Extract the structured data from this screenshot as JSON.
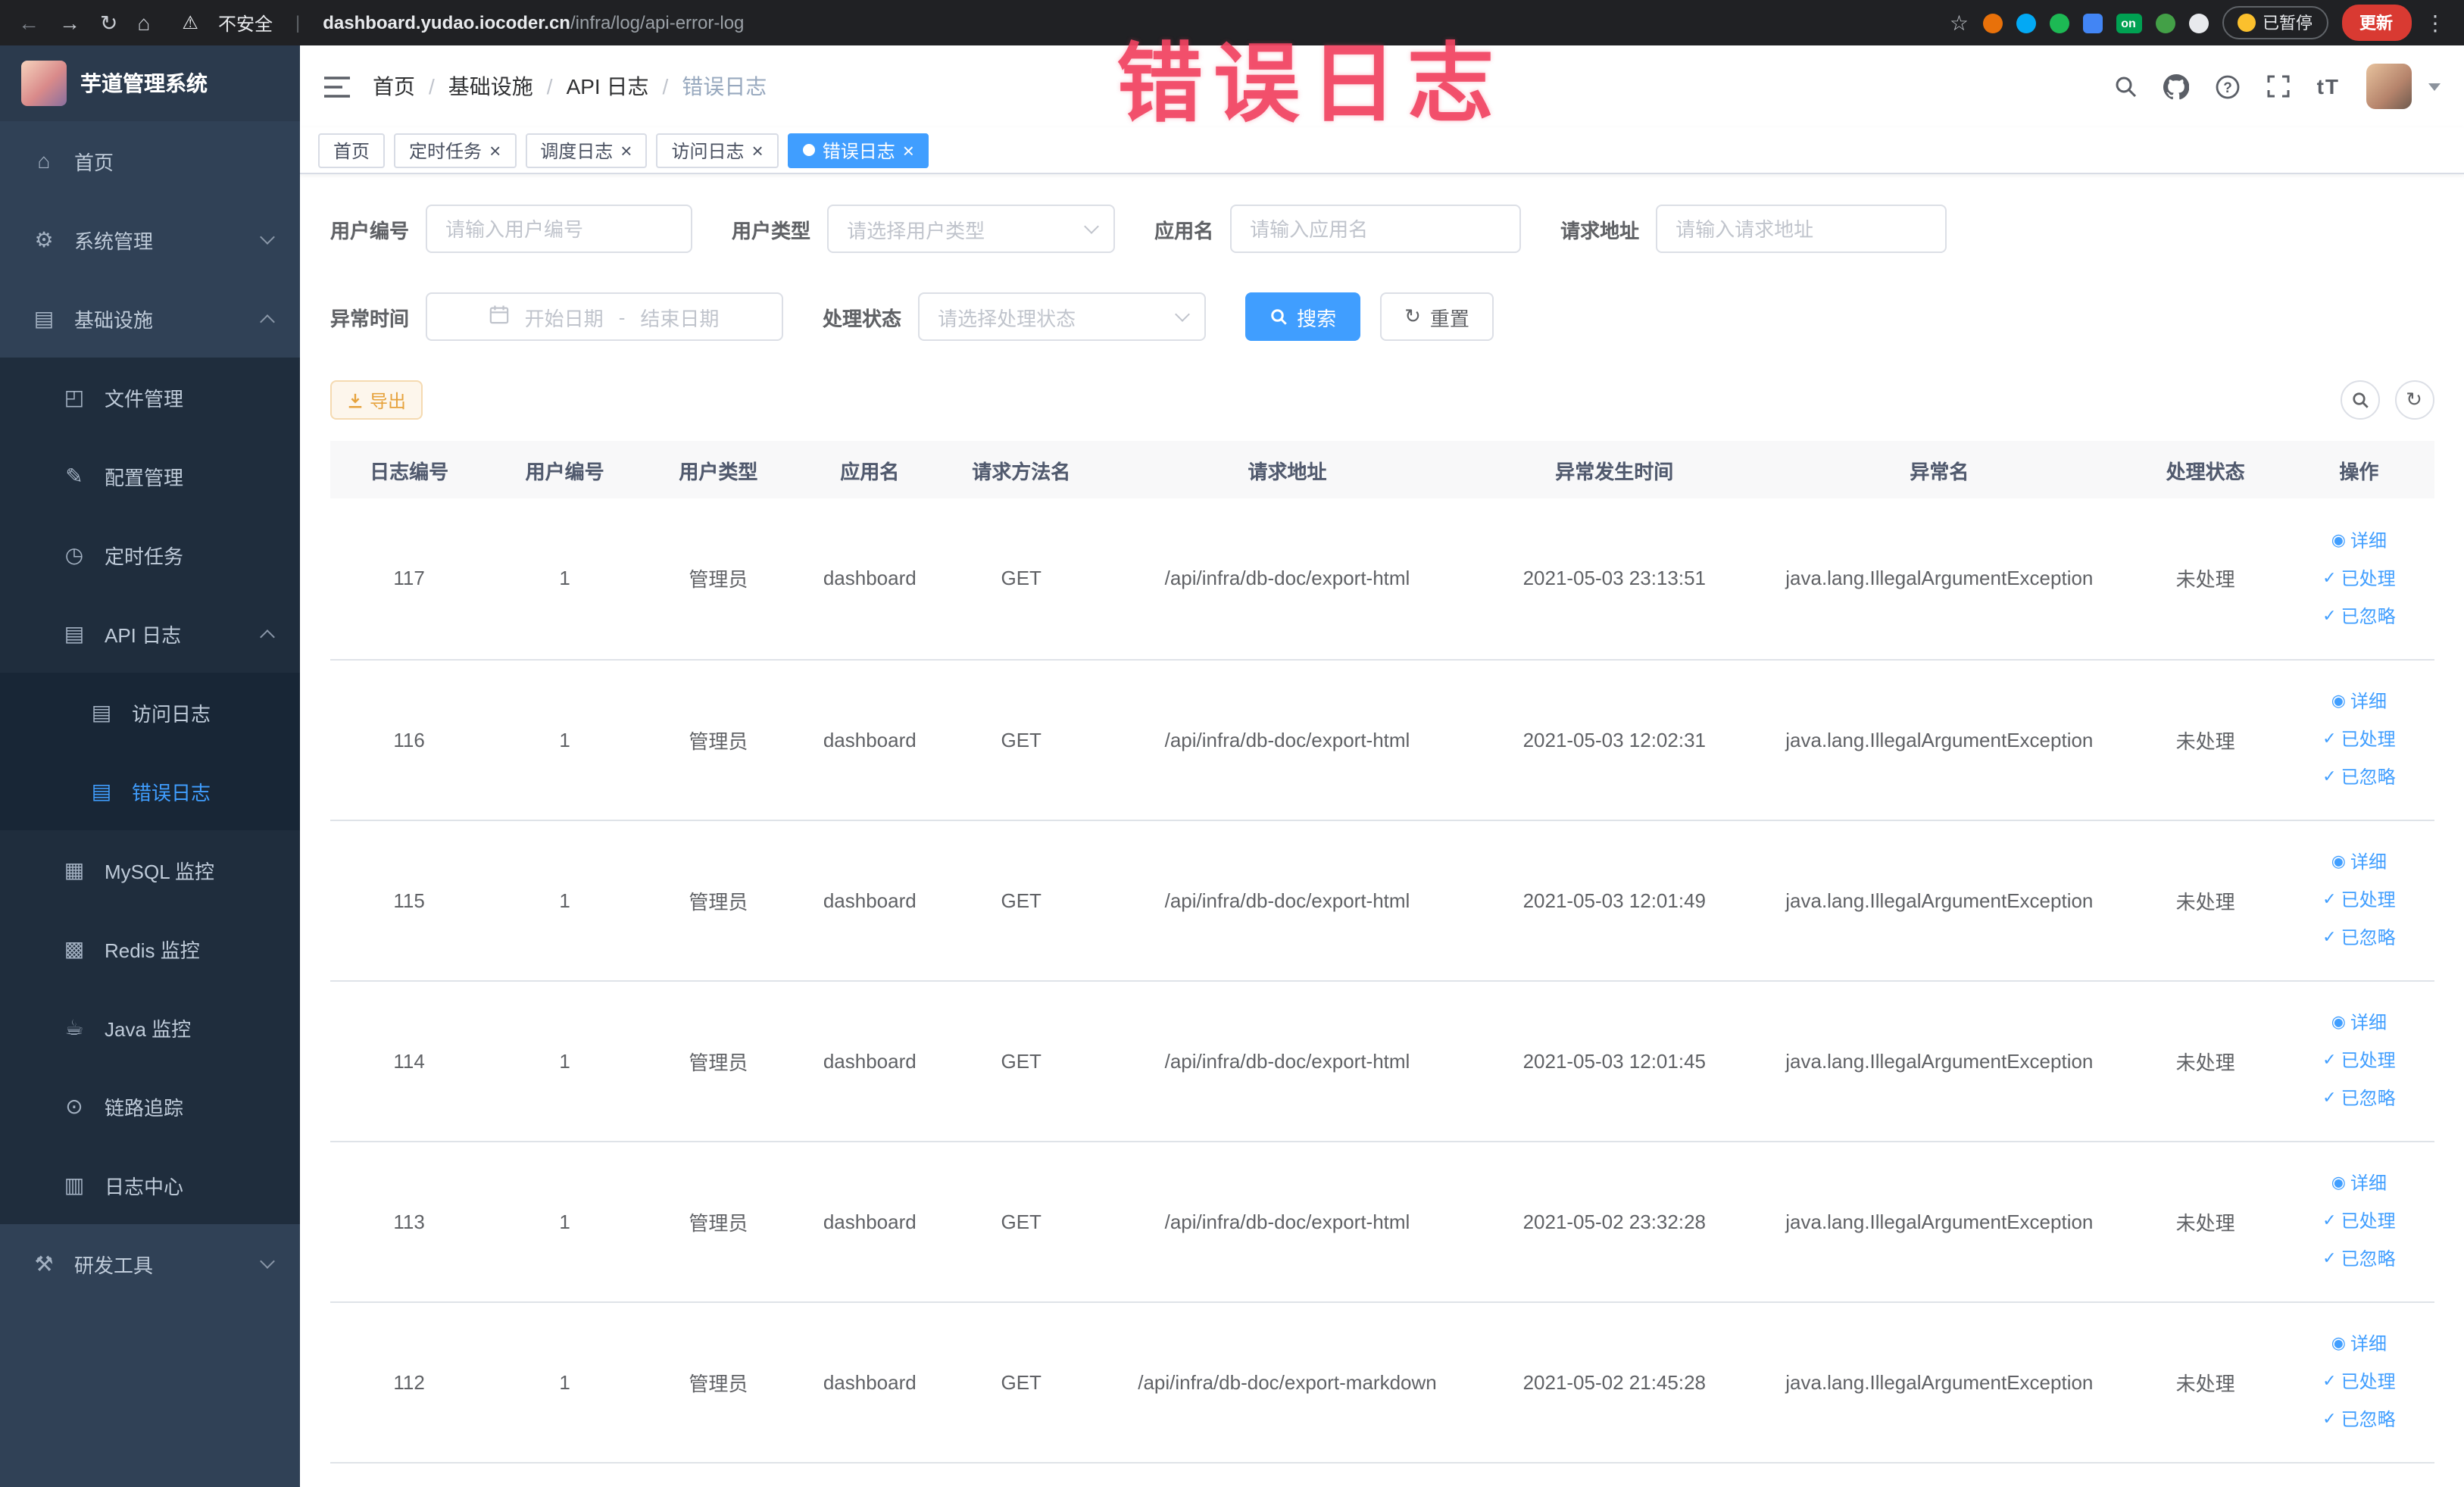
{
  "browser": {
    "security_label": "不安全",
    "url_host": "dashboard.yudao.iocoder.cn",
    "url_path": "/infra/log/api-error-log",
    "extension_on_badge": "on",
    "paused_badge": "已暂停",
    "update_button": "更新"
  },
  "overlay_annotation": "错误日志",
  "sidebar": {
    "logo_title": "芋道管理系统",
    "home": "首页",
    "system": "系统管理",
    "infra": "基础设施",
    "infra_children": {
      "file": "文件管理",
      "config": "配置管理",
      "job": "定时任务",
      "api_log": "API 日志",
      "access_log": "访问日志",
      "error_log": "错误日志",
      "mysql": "MySQL 监控",
      "redis": "Redis 监控",
      "java": "Java 监控",
      "trace": "链路追踪",
      "log_center": "日志中心"
    },
    "dev_tools": "研发工具"
  },
  "header": {
    "breadcrumb": [
      "首页",
      "基础设施",
      "API 日志",
      "错误日志"
    ]
  },
  "tabs": [
    {
      "label": "首页",
      "closable": false,
      "active": false
    },
    {
      "label": "定时任务",
      "closable": true,
      "active": false
    },
    {
      "label": "调度日志",
      "closable": true,
      "active": false
    },
    {
      "label": "访问日志",
      "closable": true,
      "active": false
    },
    {
      "label": "错误日志",
      "closable": true,
      "active": true
    }
  ],
  "filters": {
    "user_id_label": "用户编号",
    "user_id_placeholder": "请输入用户编号",
    "user_type_label": "用户类型",
    "user_type_placeholder": "请选择用户类型",
    "app_name_label": "应用名",
    "app_name_placeholder": "请输入应用名",
    "request_url_label": "请求地址",
    "request_url_placeholder": "请输入请求地址",
    "exception_time_label": "异常时间",
    "date_start_placeholder": "开始日期",
    "date_separator": "-",
    "date_end_placeholder": "结束日期",
    "process_status_label": "处理状态",
    "process_status_placeholder": "请选择处理状态",
    "search_button": "搜索",
    "reset_button": "重置"
  },
  "toolbar": {
    "export_button": "导出"
  },
  "table": {
    "columns": [
      "日志编号",
      "用户编号",
      "用户类型",
      "应用名",
      "请求方法名",
      "请求地址",
      "异常发生时间",
      "异常名",
      "处理状态",
      "操作"
    ],
    "actions": [
      {
        "label": "详细"
      },
      {
        "label": "已处理"
      },
      {
        "label": "已忽略"
      }
    ],
    "rows": [
      {
        "log_id": "117",
        "user_id": "1",
        "user_type": "管理员",
        "app_name": "dashboard",
        "method": "GET",
        "url": "/api/infra/db-doc/export-html",
        "time": "2021-05-03 23:13:51",
        "exception": "java.lang.IllegalArgumentException",
        "status": "未处理"
      },
      {
        "log_id": "116",
        "user_id": "1",
        "user_type": "管理员",
        "app_name": "dashboard",
        "method": "GET",
        "url": "/api/infra/db-doc/export-html",
        "time": "2021-05-03 12:02:31",
        "exception": "java.lang.IllegalArgumentException",
        "status": "未处理"
      },
      {
        "log_id": "115",
        "user_id": "1",
        "user_type": "管理员",
        "app_name": "dashboard",
        "method": "GET",
        "url": "/api/infra/db-doc/export-html",
        "time": "2021-05-03 12:01:49",
        "exception": "java.lang.IllegalArgumentException",
        "status": "未处理"
      },
      {
        "log_id": "114",
        "user_id": "1",
        "user_type": "管理员",
        "app_name": "dashboard",
        "method": "GET",
        "url": "/api/infra/db-doc/export-html",
        "time": "2021-05-03 12:01:45",
        "exception": "java.lang.IllegalArgumentException",
        "status": "未处理"
      },
      {
        "log_id": "113",
        "user_id": "1",
        "user_type": "管理员",
        "app_name": "dashboard",
        "method": "GET",
        "url": "/api/infra/db-doc/export-html",
        "time": "2021-05-02 23:32:28",
        "exception": "java.lang.IllegalArgumentException",
        "status": "未处理"
      },
      {
        "log_id": "112",
        "user_id": "1",
        "user_type": "管理员",
        "app_name": "dashboard",
        "method": "GET",
        "url": "/api/infra/db-doc/export-markdown",
        "time": "2021-05-02 21:45:28",
        "exception": "java.lang.IllegalArgumentException",
        "status": "未处理"
      }
    ]
  },
  "colors": {
    "accent_blue": "#409eff",
    "sidebar_bg": "#304156",
    "submenu_bg": "#1f2d3d",
    "warning_orange": "#e6a23c",
    "annotation_pink": "#f14260"
  }
}
